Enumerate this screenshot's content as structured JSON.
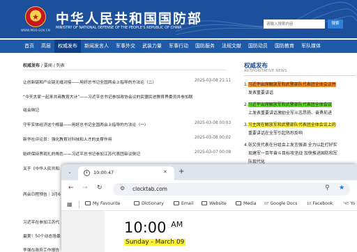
{
  "header": {
    "emblem_glyph": "★",
    "site_url": "WWW.MOD.GOV.CN",
    "title_cn": "中华人民共和国国防部",
    "title_en": "MINISTRY OF NATIONAL DEFENSE OF THE PEOPLE'S REPUBLIC OF CHINA",
    "search_placeholder": "请输入搜索内容",
    "search_button": "搜索"
  },
  "nav": {
    "items": [
      "首页",
      "高层",
      "权威发布",
      "新闻发言人",
      "军事外交",
      "武装力量",
      "军事行动",
      "国防服务",
      "法规文献",
      "国防动员",
      "国防教育",
      "军队媒体"
    ],
    "active_index": 2
  },
  "breadcrumb": {
    "current": "权威发布",
    "rest": "/ 要闻 / 列表"
  },
  "articles": [
    {
      "title": "让创新链和产业链无缝对接——用好总书记全国两会上指导的方法论（二）",
      "date": "2025-03-08 21:11"
    },
    {
      "title": "“今天大家一起来共商教育大计”——习近平总书记参加政协会议的民盟民进教育界委员并参加联",
      "date": ""
    },
    {
      "title": "组会侧记",
      "date": ""
    },
    {
      "title": "守牢实体经济这个根基——用好总书记全国两会上指导的方法论（一）",
      "date": "2025-03-08 00:03"
    },
    {
      "title": "新华社评论员：强化教育对科技和人才的支撑作用",
      "date": "2025-03-08 00:02"
    },
    {
      "title": "始终保持界观扎的角色——习近平总书记参加江苏代表团审议侧记",
      "date": "2025-03-07 00:08"
    },
    {
      "title": "关于《中华人民共和",
      "date": ""
    },
    {
      "title": "两会日程预告｜3月6",
      "date": ""
    },
    {
      "title": "习近平在参加江苏代",
      "date": ""
    },
    {
      "title": "最美！50个动态场景",
      "date": ""
    },
    {
      "title": "李强在政府工作报告",
      "date": ""
    }
  ],
  "side": {
    "title": "权威发布",
    "subtitle": "AUTHORITATIVE NEWS",
    "items": [
      {
        "num": "1.",
        "lines": [
          "习近平出席解放军和武警部队代表团全体会议并",
          "发表重要讲话"
        ],
        "highlight": "orange"
      },
      {
        "num": "2.",
        "lines": [
          "习近平出席解放军和武警部队代表团全体会议",
          "上发表重要讲话激励全军斗志昂扬、奋勇前进"
        ],
        "highlight": "green"
      },
      {
        "num": "3.",
        "lines": [
          "习主席在解放军和武警部队代表团全体会议上的",
          "重要讲话在全军引起热烈反响"
        ],
        "highlight": "yellow"
      },
      {
        "num": "4.",
        "lines": [
          "张又侠代表在分组会上发言强调 全力以赴打好实",
          "现建军一百年奋斗目标攻坚战 加快推进国防和军",
          "队现代化"
        ],
        "highlight": "none"
      }
    ]
  },
  "browser": {
    "tab_title": "10:00:47",
    "new_tab": "+",
    "url": "clocktab.com",
    "bookmarks": [
      "My Favourite",
      "Dictionary",
      "Email",
      "Website",
      "Media",
      "Google Docs",
      "Facebook",
      "Yo"
    ],
    "bookmark_prefixes": {
      "Google Docs": "07",
      "Facebook": "10",
      "Yo": "³45"
    },
    "clock_time": "10:00",
    "clock_ampm": "AM",
    "clock_date": "Sunday - March 09"
  },
  "colors": {
    "header_blue": "#1c4f9c",
    "nav_blue": "#1d5aa8",
    "highlight_orange": "#ff8a1c",
    "highlight_green": "#5de01f",
    "highlight_yellow": "#fff23a"
  }
}
